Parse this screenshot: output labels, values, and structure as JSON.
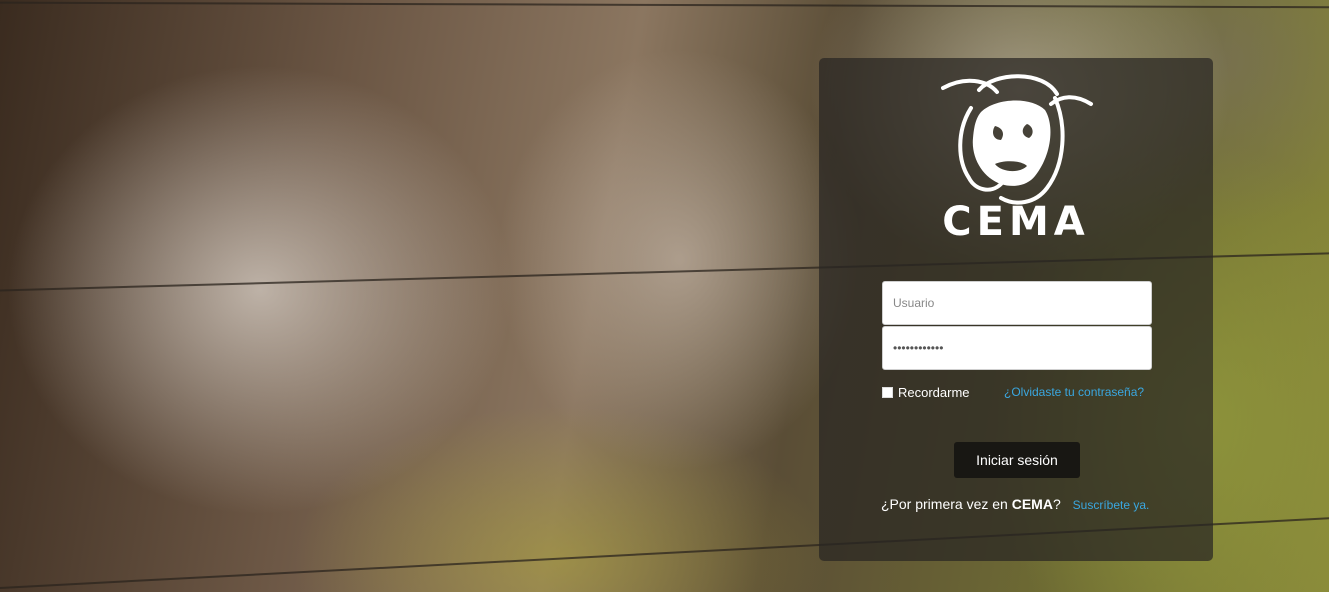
{
  "brand": {
    "name": "CEMA",
    "logo_icon": "bull-head-icon"
  },
  "login": {
    "username_placeholder": "Usuario",
    "password_value": "••••••••••••",
    "remember_label": "Recordarme",
    "forgot_label": "¿Olvidaste tu contraseña?",
    "submit_label": "Iniciar sesión"
  },
  "signup": {
    "prefix": "¿Por primera vez en ",
    "brand": "CEMA",
    "suffix": "?",
    "link_label": "Suscríbete ya."
  },
  "colors": {
    "link": "#3aa7e0",
    "button": "#181713",
    "panel": "rgba(40,38,34,0.72)"
  }
}
